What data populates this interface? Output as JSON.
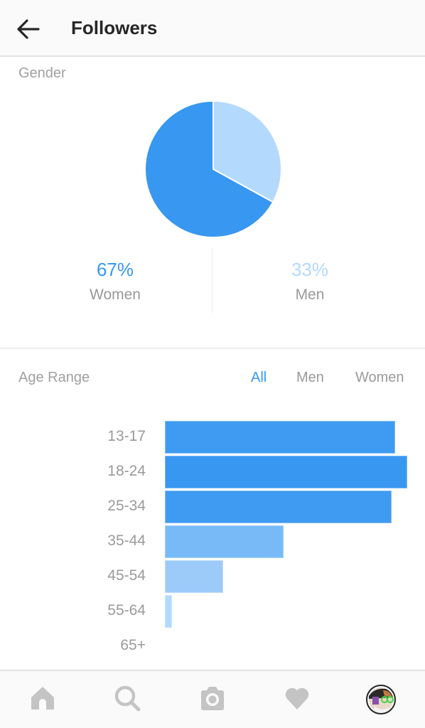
{
  "header": {
    "title": "Followers",
    "back_icon": "arrow-left-icon"
  },
  "gender": {
    "label": "Gender",
    "women": {
      "percent": "67%",
      "label": "Women",
      "color": "#3897f0"
    },
    "men": {
      "percent": "33%",
      "label": "Men",
      "color": "#b3d9fd"
    }
  },
  "age": {
    "label": "Age Range",
    "tabs": [
      {
        "label": "All",
        "active": true
      },
      {
        "label": "Men",
        "active": false
      },
      {
        "label": "Women",
        "active": false
      }
    ]
  },
  "nav": {
    "items": [
      "home-icon",
      "search-icon",
      "camera-icon",
      "heart-icon",
      "profile-avatar"
    ]
  },
  "colors": {
    "accent": "#3897f0",
    "bar_dark": "#3897f0",
    "bar_mid": "#77baf7",
    "bar_light": "#9ccbf9",
    "bar_lightest": "#b3d9fd"
  },
  "chart_data": [
    {
      "type": "pie",
      "title": "Gender",
      "categories": [
        "Women",
        "Men"
      ],
      "values": [
        67,
        33
      ],
      "colors": [
        "#3897f0",
        "#b3d9fd"
      ]
    },
    {
      "type": "bar",
      "orientation": "horizontal",
      "title": "Age Range",
      "categories": [
        "13-17",
        "18-24",
        "25-34",
        "35-44",
        "45-54",
        "55-64",
        "65+"
      ],
      "values": [
        95,
        100,
        93.5,
        49,
        24,
        3,
        0
      ],
      "value_unit": "relative to largest bar (%)",
      "colors": [
        "#3f9af1",
        "#3897f0",
        "#3f9af1",
        "#77baf7",
        "#9ccbf9",
        "#b3d9fd",
        "#b3d9fd"
      ],
      "xlabel": "",
      "ylabel": "",
      "grid": false
    }
  ]
}
